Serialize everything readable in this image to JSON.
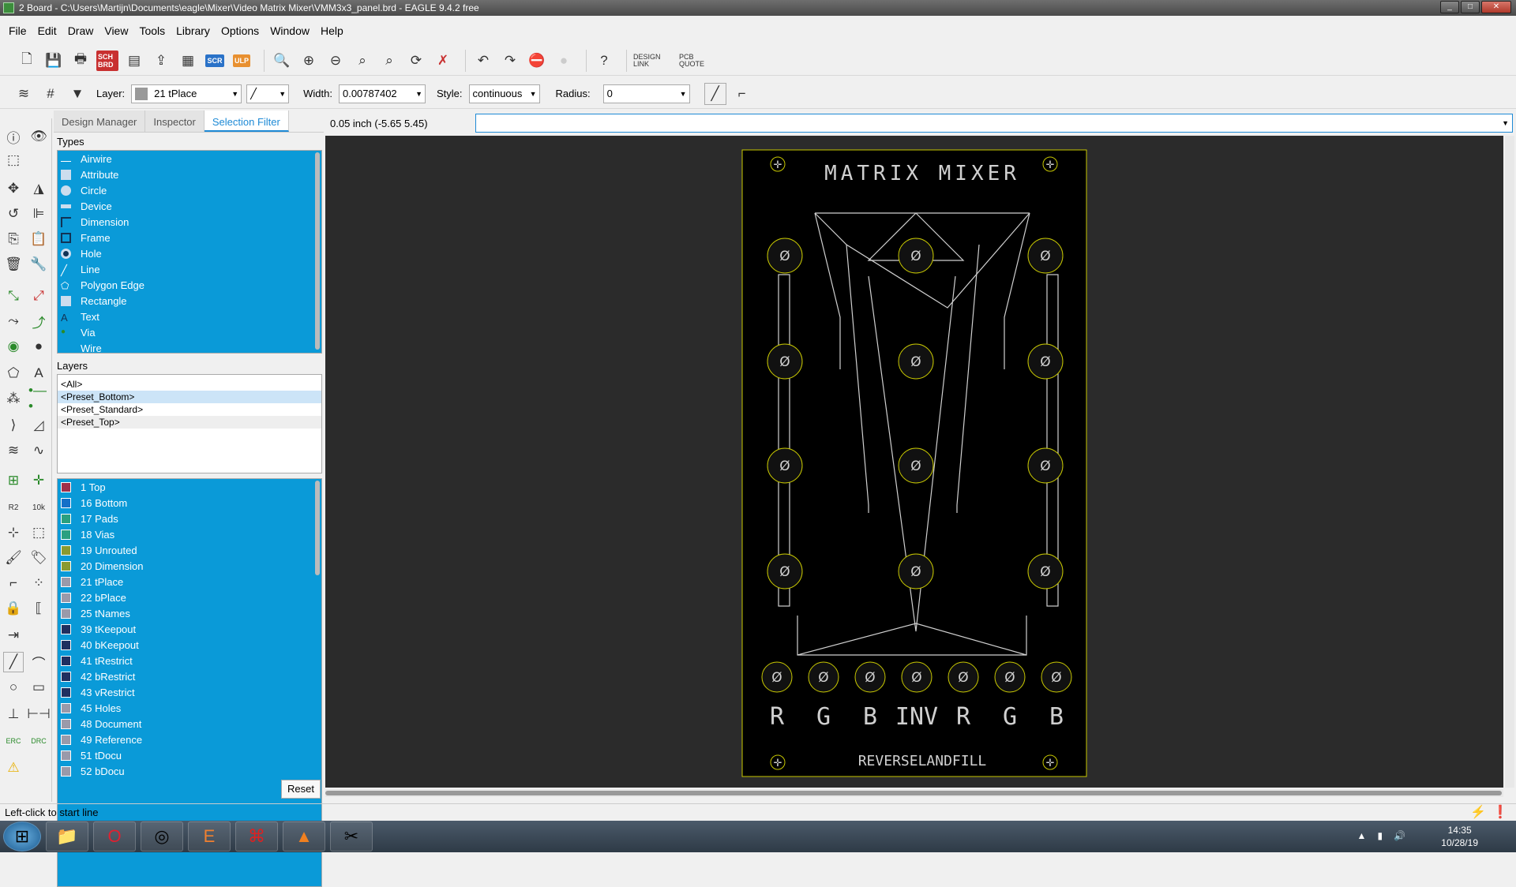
{
  "window": {
    "title": "2 Board - C:\\Users\\Martijn\\Documents\\eagle\\Mixer\\Video Matrix Mixer\\VMM3x3_panel.brd - EAGLE 9.4.2 free"
  },
  "menu": [
    "File",
    "Edit",
    "Draw",
    "View",
    "Tools",
    "Library",
    "Options",
    "Window",
    "Help"
  ],
  "toolbar": {
    "sch_label": "SCH BRD",
    "scr_label": "SCR",
    "ulp_label": "ULP",
    "design_link": "DESIGN LINK",
    "pcb_quote": "PCB QUOTE"
  },
  "params": {
    "layer_label": "Layer:",
    "layer_value": "21 tPlace",
    "width_label": "Width:",
    "width_value": "0.00787402",
    "style_label": "Style:",
    "style_value": "continuous",
    "radius_label": "Radius:",
    "radius_value": "0"
  },
  "panel": {
    "tabs": [
      "Design Manager",
      "Inspector",
      "Selection Filter"
    ],
    "types_title": "Types",
    "types": [
      "Airwire",
      "Attribute",
      "Circle",
      "Device",
      "Dimension",
      "Frame",
      "Hole",
      "Line",
      "Polygon Edge",
      "Rectangle",
      "Text",
      "Via",
      "Wire"
    ],
    "layers_title": "Layers",
    "presets": [
      "<All>",
      "<Preset_Bottom>",
      "<Preset_Standard>",
      "<Preset_Top>"
    ],
    "layers": [
      {
        "name": "1 Top",
        "color": "#a0304a"
      },
      {
        "name": "16 Bottom",
        "color": "#1470c8"
      },
      {
        "name": "17 Pads",
        "color": "#2aa080"
      },
      {
        "name": "18 Vias",
        "color": "#2aa080"
      },
      {
        "name": "19 Unrouted",
        "color": "#8a9a30"
      },
      {
        "name": "20 Dimension",
        "color": "#8a9a30"
      },
      {
        "name": "21 tPlace",
        "color": "#9a9aaa"
      },
      {
        "name": "22 bPlace",
        "color": "#9a9aaa"
      },
      {
        "name": "25 tNames",
        "color": "#9a9aaa"
      },
      {
        "name": "39 tKeepout",
        "color": "#203060"
      },
      {
        "name": "40 bKeepout",
        "color": "#203060"
      },
      {
        "name": "41 tRestrict",
        "color": "#203060"
      },
      {
        "name": "42 bRestrict",
        "color": "#203060"
      },
      {
        "name": "43 vRestrict",
        "color": "#203060"
      },
      {
        "name": "45 Holes",
        "color": "#9a9aaa"
      },
      {
        "name": "48 Document",
        "color": "#9a9aaa"
      },
      {
        "name": "49 Reference",
        "color": "#9a9aaa"
      },
      {
        "name": "51 tDocu",
        "color": "#9a9aaa"
      },
      {
        "name": "52 bDocu",
        "color": "#9a9aaa"
      }
    ],
    "reset_label": "Reset"
  },
  "coord": "0.05 inch (-5.65 5.45)",
  "board": {
    "title": "MATRIX MIXER",
    "footer": "REVERSELANDFILL",
    "bottom_labels": [
      "R",
      "G",
      "B",
      "INV",
      "R",
      "G",
      "B"
    ],
    "hole_symbol": "Ø"
  },
  "status": "Left-click to start line",
  "clock": {
    "time": "14:35",
    "date": "10/28/19"
  },
  "colors": {
    "accent": "#0a9ad8",
    "canvas": "#2b2b2b",
    "board_outline": "#c8c800",
    "drawing": "#d0d0d0"
  }
}
